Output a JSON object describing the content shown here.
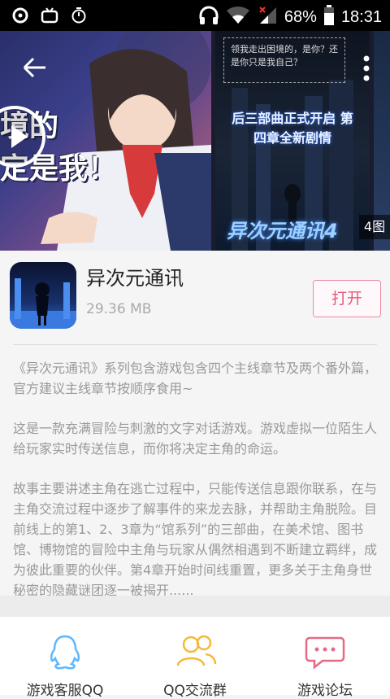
{
  "status_bar": {
    "battery_pct": "68%",
    "time": "18:31",
    "icons": [
      "sync-icon",
      "tv-icon",
      "alarm-icon",
      "headphones-icon",
      "wifi-icon",
      "signal-icon",
      "battery-icon"
    ]
  },
  "banner": {
    "shot1_text": "境的\n定是我！",
    "shot2_bubble": "领我走出困境的，是你？还是你只是我自己？",
    "shot2_headline": "后三部曲正式开启 第四章全新剧情",
    "shot2_logo": "异次元通讯4",
    "image_count": "4图"
  },
  "app": {
    "name": "异次元通讯",
    "size": "29.36 MB",
    "open_label": "打开"
  },
  "description": {
    "paragraphs": [
      "《异次元通讯》系列包含游戏包含四个主线章节及两个番外篇，官方建议主线章节按顺序食用~",
      "这是一款充满冒险与刺激的文字对话游戏。游戏虚拟一位陌生人给玩家实时传送信息，而你将决定主角的命运。",
      "故事主要讲述主角在逃亡过程中，只能传送信息跟你联系，在与主角交流过程中逐步了解事件的来龙去脉，并帮助主角脱险。目前线上的第1、2、3章为“馆系列”的三部曲，在美术馆、图书馆、博物馆的冒险中主角与玩家从偶然相遇到不断建立羁绊，成为彼此重要的伙伴。第4章开始时间线重置，更多关于主角身世秘密的隐藏谜团逐一被揭开......"
    ]
  },
  "bottom_nav": {
    "items": [
      {
        "label": "游戏客服QQ",
        "icon": "qq-penguin-icon"
      },
      {
        "label": "QQ交流群",
        "icon": "group-icon"
      },
      {
        "label": "游戏论坛",
        "icon": "chat-bubble-icon"
      }
    ]
  },
  "colors": {
    "accent": "#e25a7a",
    "qq_icon": "#5cb8ff",
    "group_icon": "#f5b93a",
    "forum_icon": "#e46a86"
  }
}
